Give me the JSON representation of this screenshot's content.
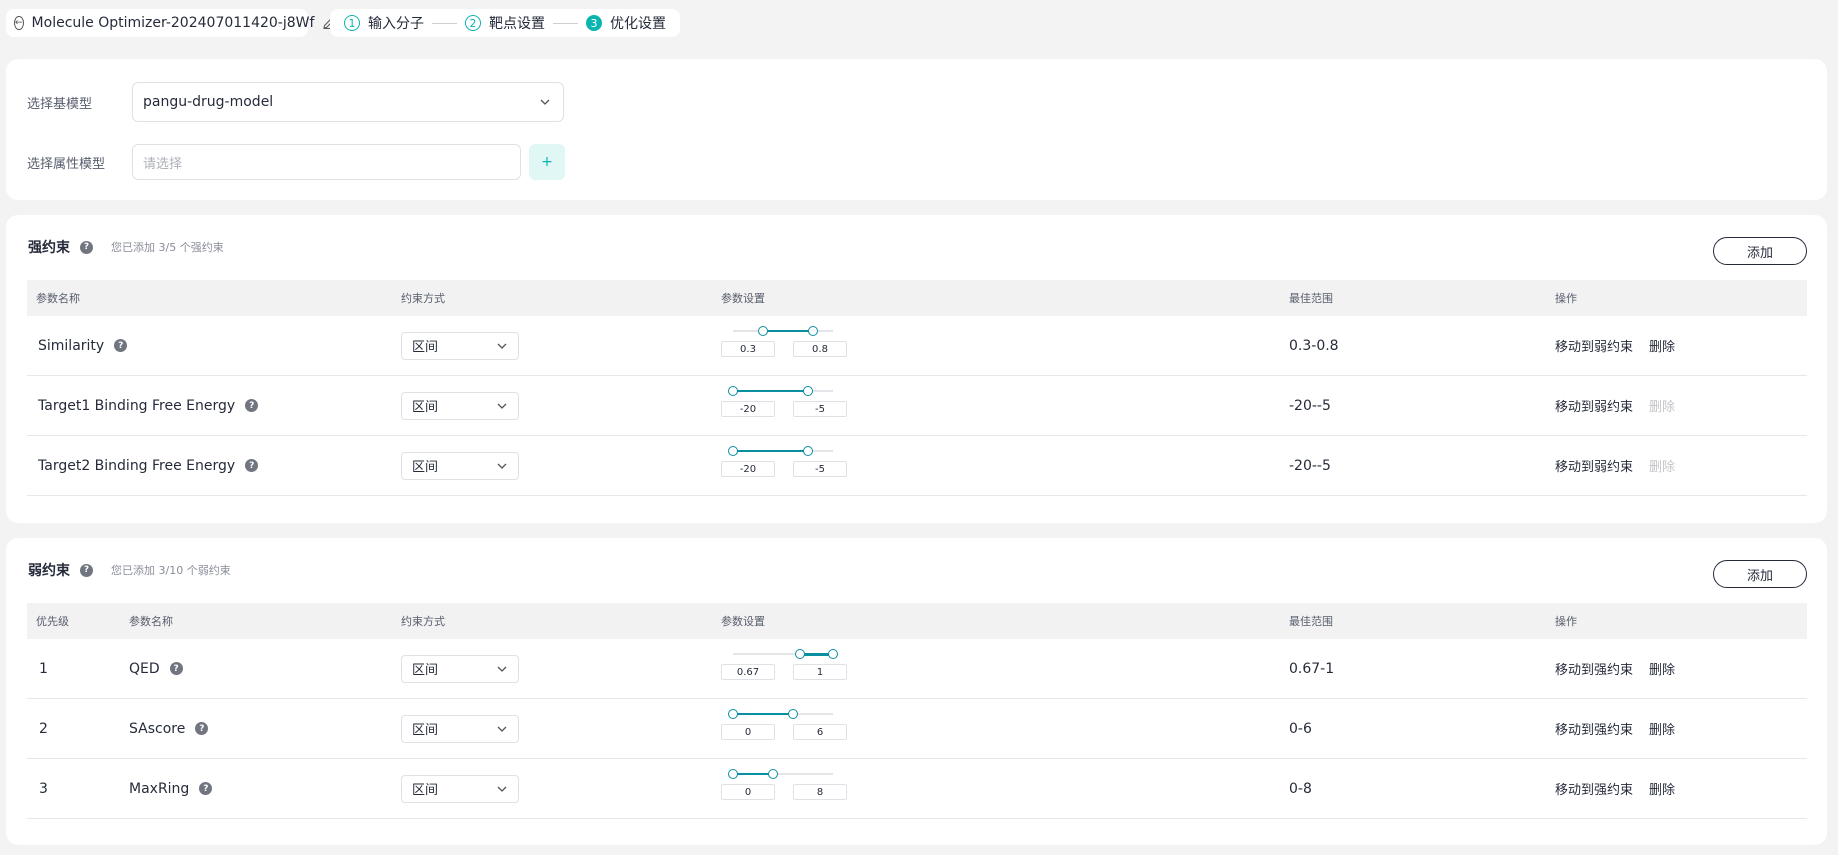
{
  "header": {
    "title": "Molecule Optimizer-202407011420-j8Wf",
    "steps": [
      {
        "num": "1",
        "label": "输入分子"
      },
      {
        "num": "2",
        "label": "靶点设置"
      },
      {
        "num": "3",
        "label": "优化设置"
      }
    ]
  },
  "models": {
    "base_label": "选择基模型",
    "base_value": "pangu-drug-model",
    "attr_label": "选择属性模型",
    "attr_placeholder": "请选择",
    "plus": "+"
  },
  "strong": {
    "title": "强约束",
    "hint": "您已添加 3/5 个强约束",
    "add_label": "添加",
    "columns": [
      "参数名称",
      "约束方式",
      "参数设置",
      "最佳范围",
      "操作"
    ],
    "rows": [
      {
        "name": "Similarity",
        "method": "区间",
        "min": 0,
        "max": 1,
        "lo": "0.3",
        "hi": "0.8",
        "best": "0.3-0.8",
        "move": "移动到弱约束",
        "del": "删除",
        "del_disabled": false
      },
      {
        "name": "Target1 Binding Free Energy",
        "method": "区间",
        "min": -20,
        "max": 0,
        "lo": "-20",
        "hi": "-5",
        "best": "-20--5",
        "move": "移动到弱约束",
        "del": "删除",
        "del_disabled": true
      },
      {
        "name": "Target2 Binding Free Energy",
        "method": "区间",
        "min": -20,
        "max": 0,
        "lo": "-20",
        "hi": "-5",
        "best": "-20--5",
        "move": "移动到弱约束",
        "del": "删除",
        "del_disabled": true
      }
    ]
  },
  "weak": {
    "title": "弱约束",
    "hint": "您已添加 3/10 个弱约束",
    "add_label": "添加",
    "columns": [
      "优先级",
      "参数名称",
      "约束方式",
      "参数设置",
      "最佳范围",
      "操作"
    ],
    "rows": [
      {
        "priority": "1",
        "name": "QED",
        "method": "区间",
        "min": 0,
        "max": 1,
        "lo": "0.67",
        "hi": "1",
        "best": "0.67-1",
        "move": "移动到强约束",
        "del": "删除",
        "del_disabled": false
      },
      {
        "priority": "2",
        "name": "SAscore",
        "method": "区间",
        "min": 0,
        "max": 10,
        "lo": "0",
        "hi": "6",
        "best": "0-6",
        "move": "移动到强约束",
        "del": "删除",
        "del_disabled": false
      },
      {
        "priority": "3",
        "name": "MaxRing",
        "method": "区间",
        "min": 0,
        "max": 20,
        "lo": "0",
        "hi": "8",
        "best": "0-8",
        "move": "移动到强约束",
        "del": "删除",
        "del_disabled": false
      }
    ]
  }
}
